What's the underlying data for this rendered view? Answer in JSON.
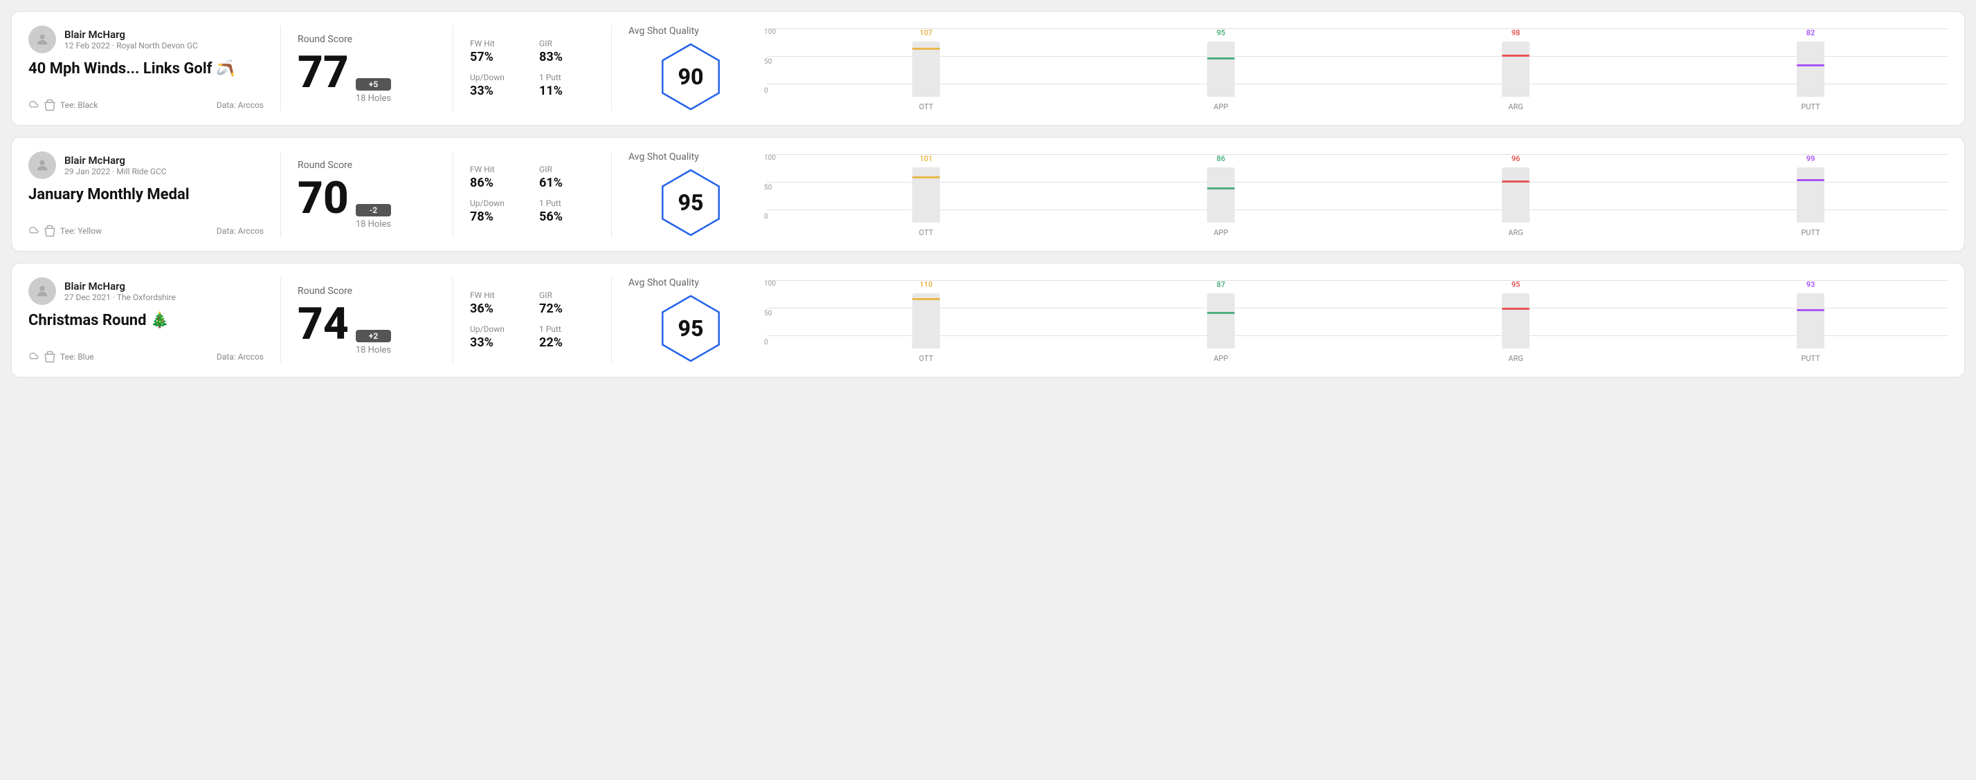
{
  "rounds": [
    {
      "id": "round-1",
      "user": {
        "name": "Blair McHarg",
        "date": "12 Feb 2022 · Royal North Devon GC"
      },
      "title": "40 Mph Winds... Links Golf 🪃",
      "tee": "Black",
      "data_source": "Data: Arccos",
      "round_score_label": "Round Score",
      "score": "77",
      "score_diff": "+5",
      "holes": "18 Holes",
      "fw_hit_label": "FW Hit",
      "fw_hit_value": "57%",
      "gir_label": "GIR",
      "gir_value": "83%",
      "updown_label": "Up/Down",
      "updown_value": "33%",
      "oneputt_label": "1 Putt",
      "oneputt_value": "11%",
      "avg_shot_label": "Avg Shot Quality",
      "avg_shot_score": "90",
      "chart": {
        "bars": [
          {
            "label": "OTT",
            "top_value": "107",
            "pct": 85,
            "color_class": "ott-line"
          },
          {
            "label": "APP",
            "top_value": "95",
            "pct": 68,
            "color_class": "app-line"
          },
          {
            "label": "ARG",
            "top_value": "98",
            "pct": 72,
            "color_class": "arg-line"
          },
          {
            "label": "PUTT",
            "top_value": "82",
            "pct": 55,
            "color_class": "putt-line"
          }
        ],
        "y_labels": [
          "100",
          "50",
          "0"
        ]
      }
    },
    {
      "id": "round-2",
      "user": {
        "name": "Blair McHarg",
        "date": "29 Jan 2022 · Mill Ride GCC"
      },
      "title": "January Monthly Medal",
      "tee": "Yellow",
      "data_source": "Data: Arccos",
      "round_score_label": "Round Score",
      "score": "70",
      "score_diff": "-2",
      "holes": "18 Holes",
      "fw_hit_label": "FW Hit",
      "fw_hit_value": "86%",
      "gir_label": "GIR",
      "gir_value": "61%",
      "updown_label": "Up/Down",
      "updown_value": "78%",
      "oneputt_label": "1 Putt",
      "oneputt_value": "56%",
      "avg_shot_label": "Avg Shot Quality",
      "avg_shot_score": "95",
      "chart": {
        "bars": [
          {
            "label": "OTT",
            "top_value": "101",
            "pct": 80,
            "color_class": "ott-line"
          },
          {
            "label": "APP",
            "top_value": "86",
            "pct": 60,
            "color_class": "app-line"
          },
          {
            "label": "ARG",
            "top_value": "96",
            "pct": 72,
            "color_class": "arg-line"
          },
          {
            "label": "PUTT",
            "top_value": "99",
            "pct": 75,
            "color_class": "putt-line"
          }
        ],
        "y_labels": [
          "100",
          "50",
          "0"
        ]
      }
    },
    {
      "id": "round-3",
      "user": {
        "name": "Blair McHarg",
        "date": "27 Dec 2021 · The Oxfordshire"
      },
      "title": "Christmas Round 🎄",
      "tee": "Blue",
      "data_source": "Data: Arccos",
      "round_score_label": "Round Score",
      "score": "74",
      "score_diff": "+2",
      "holes": "18 Holes",
      "fw_hit_label": "FW Hit",
      "fw_hit_value": "36%",
      "gir_label": "GIR",
      "gir_value": "72%",
      "updown_label": "Up/Down",
      "updown_value": "33%",
      "oneputt_label": "1 Putt",
      "oneputt_value": "22%",
      "avg_shot_label": "Avg Shot Quality",
      "avg_shot_score": "95",
      "chart": {
        "bars": [
          {
            "label": "OTT",
            "top_value": "110",
            "pct": 88,
            "color_class": "ott-line"
          },
          {
            "label": "APP",
            "top_value": "87",
            "pct": 62,
            "color_class": "app-line"
          },
          {
            "label": "ARG",
            "top_value": "95",
            "pct": 70,
            "color_class": "arg-line"
          },
          {
            "label": "PUTT",
            "top_value": "93",
            "pct": 68,
            "color_class": "putt-line"
          }
        ],
        "y_labels": [
          "100",
          "50",
          "0"
        ]
      }
    }
  ]
}
